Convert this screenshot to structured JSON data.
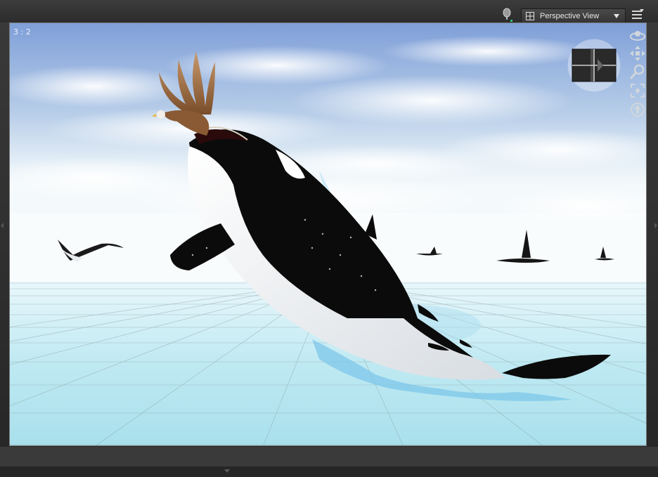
{
  "viewport": {
    "aspect_label": "3 : 2",
    "view_name": "Perspective View"
  },
  "icons": {
    "pin": "pin-icon",
    "view_layout": "viewport-layout-icon",
    "dropdown": "chevron-down-icon",
    "options": "viewport-options-icon",
    "orbit": "orbit-icon",
    "pan": "pan-icon",
    "zoom": "zoom-icon",
    "frame": "frame-selection-icon",
    "reset": "reset-view-icon",
    "cube": "view-cube-icon"
  },
  "colors": {
    "chrome_dark": "#2a2a2a",
    "accent_green": "#2bd07a",
    "viewport_border": "#777777"
  }
}
